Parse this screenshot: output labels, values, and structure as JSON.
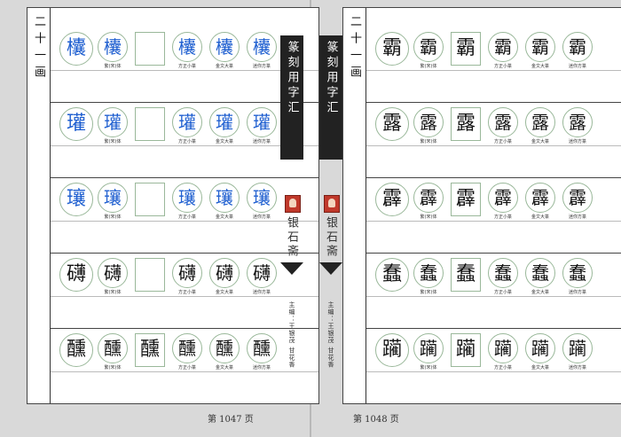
{
  "left": {
    "section": "二十一画",
    "footer": "第 1047 页",
    "blocks": [
      {
        "head": "欜",
        "chars": [
          "欜",
          "",
          "欜",
          "欜",
          "欜"
        ],
        "color": "blue"
      },
      {
        "head": "瓘",
        "chars": [
          "瓘",
          "",
          "瓘",
          "瓘",
          "瓘"
        ],
        "color": "blue"
      },
      {
        "head": "瓖",
        "chars": [
          "瓖",
          "",
          "瓖",
          "瓖",
          "瓖"
        ],
        "color": "blue"
      },
      {
        "head": "礴",
        "chars": [
          "礴",
          "",
          "礴",
          "礴",
          "礴"
        ],
        "color": "black"
      },
      {
        "head": "醺",
        "chars": [
          "醺",
          "醺",
          "醺",
          "醺",
          "醺"
        ],
        "color": "black"
      }
    ]
  },
  "right": {
    "section": "二十一画",
    "footer": "第 1048 页",
    "blocks": [
      {
        "head": "霸",
        "chars": [
          "霸",
          "霸",
          "霸",
          "霸",
          "霸"
        ]
      },
      {
        "head": "露",
        "chars": [
          "露",
          "露",
          "露",
          "露",
          "露"
        ]
      },
      {
        "head": "霹",
        "chars": [
          "霹",
          "霹",
          "霹",
          "霹",
          "霹"
        ]
      },
      {
        "head": "蠢",
        "chars": [
          "蠢",
          "蠢",
          "蠢",
          "蠢",
          "蠢"
        ]
      },
      {
        "head": "躏",
        "chars": [
          "躏",
          "躏",
          "躏",
          "躏",
          "躏"
        ]
      }
    ]
  },
  "captions": [
    "繁(宋)体",
    "方正小篆",
    "金文大篆",
    "迷你方篆"
  ],
  "spine": {
    "title": "篆刻用字汇",
    "publisher": "银石斋",
    "editors": "主编：王银茂 甘花香"
  }
}
